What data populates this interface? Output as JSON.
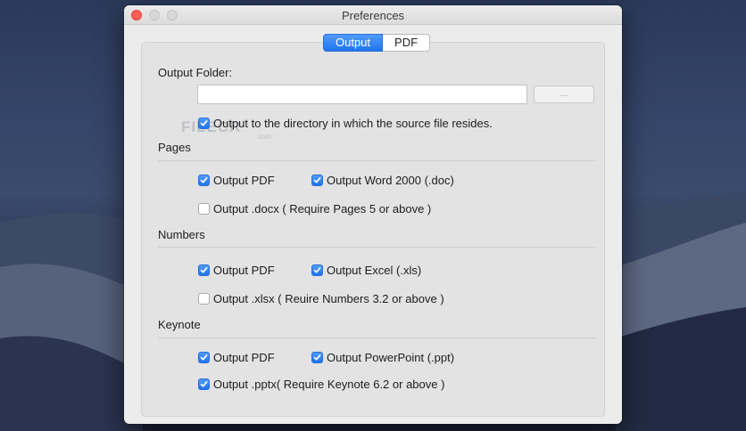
{
  "window": {
    "title": "Preferences",
    "accent_color": "#1f74f0"
  },
  "tabs": [
    {
      "label": "Output",
      "active": true
    },
    {
      "label": "PDF",
      "active": false
    }
  ],
  "output_folder": {
    "label": "Output Folder:",
    "value": "",
    "browse_label": "...",
    "same_dir": {
      "label": "Output to the directory in which the source file resides.",
      "checked": true
    }
  },
  "pages": {
    "title": "Pages",
    "options": [
      {
        "label": "Output PDF",
        "checked": true
      },
      {
        "label": "Output Word 2000 (.doc)",
        "checked": true
      },
      {
        "label": "Output .docx ( Require Pages 5 or above )",
        "checked": false
      }
    ]
  },
  "numbers": {
    "title": "Numbers",
    "options": [
      {
        "label": "Output PDF",
        "checked": true
      },
      {
        "label": "Output Excel (.xls)",
        "checked": true
      },
      {
        "label": "Output .xlsx ( Reuire Numbers 3.2 or above )",
        "checked": false
      }
    ]
  },
  "keynote": {
    "title": "Keynote",
    "options": [
      {
        "label": "Output PDF",
        "checked": true
      },
      {
        "label": "Output PowerPoint (.ppt)",
        "checked": true
      },
      {
        "label": "Output .pptx( Require Keynote 6.2 or above )",
        "checked": true
      }
    ]
  },
  "watermark": {
    "text": "FILECR",
    "sub": ".com"
  }
}
